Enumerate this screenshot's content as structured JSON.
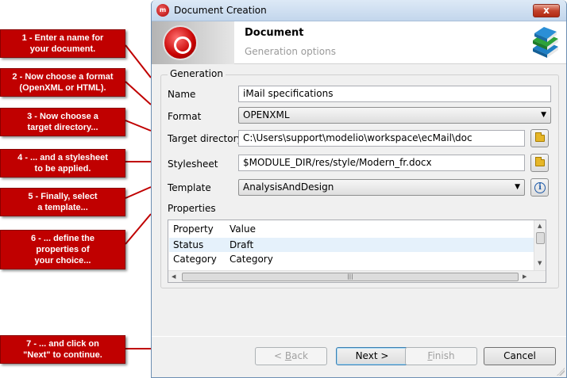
{
  "callouts": [
    "1 - Enter a name for\nyour document.",
    "2 - Now choose a format\n(OpenXML or HTML).",
    "3 - Now choose a\ntarget directory...",
    "4 - ... and a stylesheet\nto be applied.",
    "5 - Finally, select\na template...",
    "6 - ... define the\nproperties of\nyour choice...",
    "7 - ... and click on\n\"Next\" to continue."
  ],
  "window": {
    "title": "Document Creation",
    "close_label": "x"
  },
  "header": {
    "title": "Document",
    "subtitle": "Generation options"
  },
  "group": {
    "legend": "Generation"
  },
  "form": {
    "name_label": "Name",
    "name_value": "iMail specifications",
    "format_label": "Format",
    "format_value": "OPENXML",
    "target_label": "Target directory",
    "target_value": "C:\\Users\\support\\modelio\\workspace\\ecMail\\doc",
    "stylesheet_label": "Stylesheet",
    "stylesheet_value": "$MODULE_DIR/res/style/Modern_fr.docx",
    "template_label": "Template",
    "template_value": "AnalysisAndDesign",
    "properties_label": "Properties"
  },
  "properties": {
    "columns": [
      "Property",
      "Value"
    ],
    "rows": [
      [
        "Status",
        "Draft"
      ],
      [
        "Category",
        "Category"
      ]
    ]
  },
  "buttons": {
    "back_prefix": "< ",
    "back_accel": "B",
    "back_rest": "ack",
    "next": "Next >",
    "finish_accel": "F",
    "finish_rest": "inish",
    "cancel": "Cancel"
  },
  "icons": {
    "app": "modelio-logo-icon",
    "banner": "modelio-logo-icon",
    "books": "books-icon",
    "folder": "folder-icon",
    "info": "info-icon"
  },
  "colors": {
    "callout_red": "#c00000",
    "title_bar": "#c3d6ec",
    "selected_row": "#e5f1fb"
  }
}
